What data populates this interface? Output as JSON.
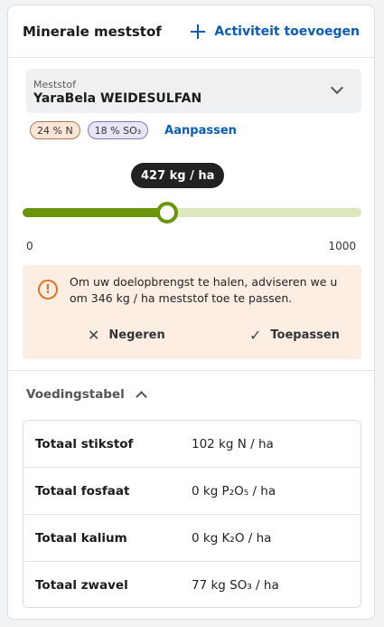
{
  "header": {
    "title": "Minerale meststof",
    "add_label": "Activiteit toevoegen"
  },
  "fertilizer_select": {
    "label": "Meststof",
    "value": "YaraBela WEIDESULFAN"
  },
  "nutrients": {
    "chips": [
      "24 % N",
      "18 % SO₃"
    ],
    "adjust_label": "Aanpassen"
  },
  "slider": {
    "value": 427,
    "value_label": "427 kg / ha",
    "min": 0,
    "max": 1000,
    "min_label": "0",
    "max_label": "1000"
  },
  "advice": {
    "message": "Om uw doelopbrengst te halen, adviseren we u om 346 kg / ha meststof toe te passen.",
    "dismiss_label": "Negeren",
    "apply_label": "Toepassen"
  },
  "nutrition_table": {
    "title": "Voedingstabel",
    "rows": [
      {
        "label": "Totaal stikstof",
        "value": "102 kg N / ha"
      },
      {
        "label": "Totaal fosfaat",
        "value": "0 kg P₂O₅ / ha"
      },
      {
        "label": "Totaal kalium",
        "value": "0 kg K₂O / ha"
      },
      {
        "label": "Totaal zwavel",
        "value": "77 kg SO₃ / ha"
      }
    ]
  },
  "colors": {
    "accent": "#0a5bbd",
    "slider": "#6a950a",
    "warning": "#e0731c"
  }
}
